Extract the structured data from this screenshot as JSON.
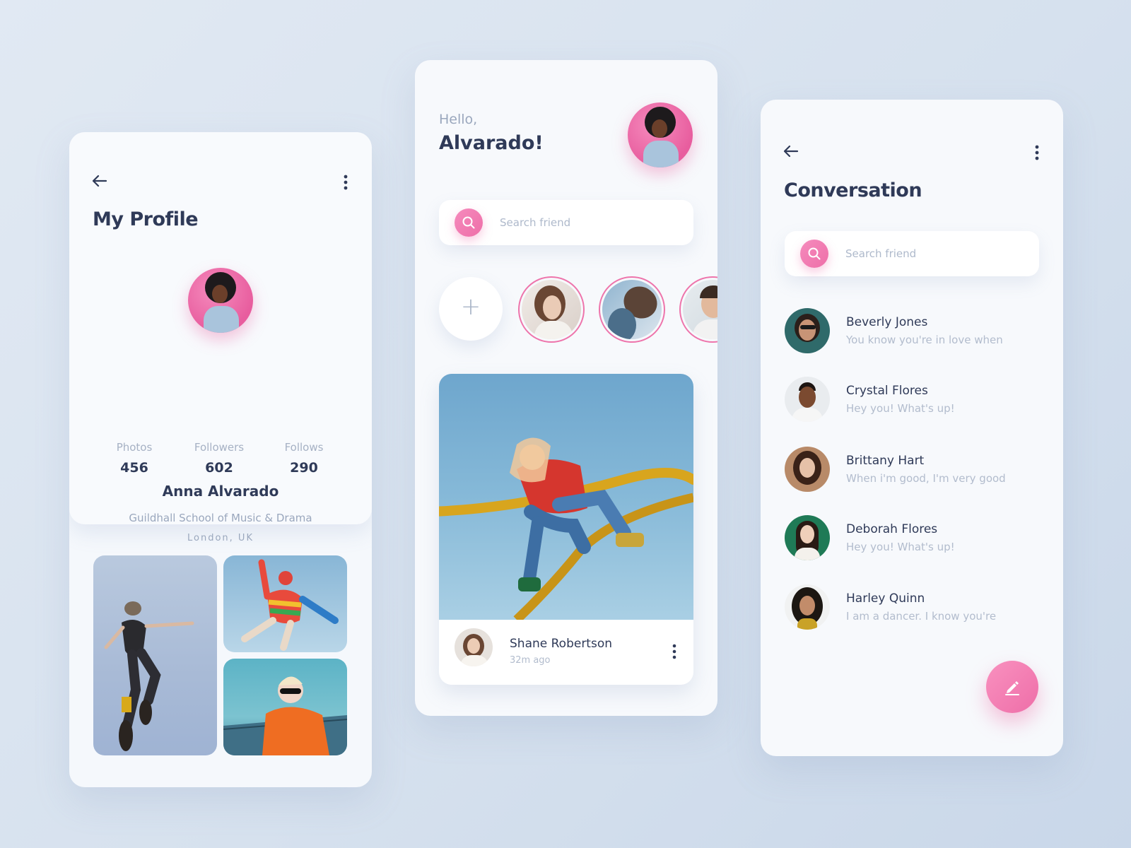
{
  "colors": {
    "accent_pink": "#ee6ea8",
    "text_dark": "#2f3a58",
    "text_muted": "#9aa7bd",
    "background": "#dbe5f1"
  },
  "profile": {
    "title": "My Profile",
    "back_icon": "arrow-left-icon",
    "menu_icon": "more-vertical-icon",
    "name": "Anna Alvarado",
    "school": "Guildhall School of Music & Drama",
    "location": "London, UK",
    "stats": [
      {
        "label": "Photos",
        "value": "456"
      },
      {
        "label": "Followers",
        "value": "602"
      },
      {
        "label": "Follows",
        "value": "290"
      }
    ]
  },
  "feed": {
    "greeting": "Hello,",
    "user_name": "Alvarado!",
    "search": {
      "placeholder": "Search friend",
      "icon": "search-icon"
    },
    "add_story_icon": "plus-icon",
    "post": {
      "author": "Shane Robertson",
      "time": "32m ago",
      "menu_icon": "more-vertical-icon"
    }
  },
  "conversation": {
    "title": "Conversation",
    "back_icon": "arrow-left-icon",
    "menu_icon": "more-vertical-icon",
    "search": {
      "placeholder": "Search friend",
      "icon": "search-icon"
    },
    "items": [
      {
        "name": "Beverly Jones",
        "message": "You know you're in love when"
      },
      {
        "name": "Crystal Flores",
        "message": "Hey you! What's up!"
      },
      {
        "name": "Brittany Hart",
        "message": "When i'm good, I'm very good"
      },
      {
        "name": "Deborah Flores",
        "message": "Hey you! What's up!"
      },
      {
        "name": "Harley Quinn",
        "message": "I am a dancer. I know you're"
      }
    ],
    "compose_icon": "pencil-icon"
  }
}
